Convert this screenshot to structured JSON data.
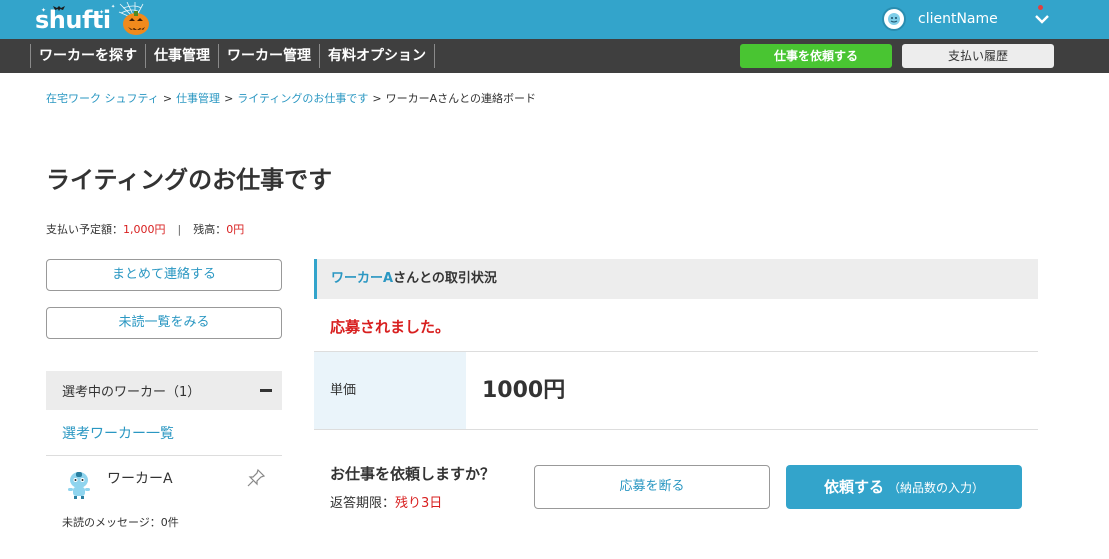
{
  "header": {
    "logo_text": "shufti",
    "user_name": "clientName",
    "accent_color": "#33a4cb"
  },
  "nav": {
    "items": [
      "ワーカーを探す",
      "仕事管理",
      "ワーカー管理",
      "有料オプション"
    ],
    "request_button": "仕事を依頼する",
    "history_button": "支払い履歴"
  },
  "breadcrumb": {
    "items": [
      "在宅ワーク シュフティ",
      "仕事管理",
      "ライティングのお仕事です"
    ],
    "current": "ワーカーAさんとの連絡ボード",
    "separator": ">"
  },
  "page": {
    "title": "ライティングのお仕事です",
    "payment_label": "支払い予定額：",
    "payment_value": "1,000円",
    "payment_divider": "|",
    "balance_label": "残高：",
    "balance_value": "0円"
  },
  "sidebar": {
    "bulk_contact_button": "まとめて連絡する",
    "unread_list_button": "未読一覧をみる",
    "selecting_header": "選考中のワーカー（1）",
    "worker_list_link": "選考ワーカー一覧",
    "worker_name": "ワーカーA",
    "unread_messages": "未読のメッセージ：0件"
  },
  "status": {
    "worker_name": "ワーカーA",
    "header_suffix": "さんとの取引状況",
    "message": "応募されました。",
    "price_label": "単価",
    "price_value": "1000円"
  },
  "action": {
    "question": "お仕事を依頼しますか？",
    "deadline_label": "返答期限：",
    "deadline_value": "残り3日",
    "decline_button": "応募を断る",
    "order_button_main": "依頼する",
    "order_button_sub": "（納品数の入力）"
  }
}
